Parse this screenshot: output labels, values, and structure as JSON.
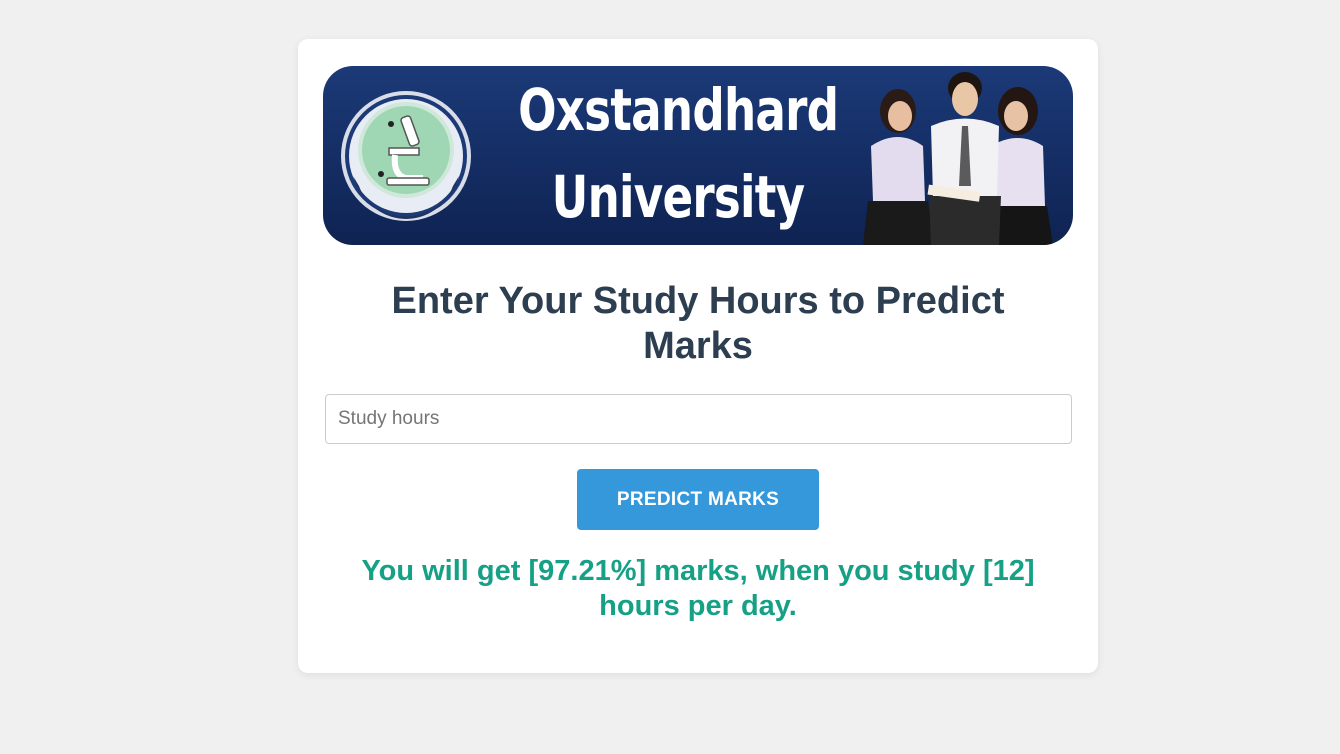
{
  "banner": {
    "line1": "Oxstandhard",
    "line2": "University",
    "logo_icon": "microscope-emblem-icon",
    "photo": "students-photo"
  },
  "form": {
    "heading": "Enter Your Study Hours to Predict Marks",
    "input_placeholder": "Study hours",
    "input_value": "",
    "button_label": "PREDICT MARKS"
  },
  "result": {
    "message": "You will get [97.21%] marks, when you study [12] hours per day."
  },
  "colors": {
    "page_background": "#f0f0f0",
    "card_background": "#ffffff",
    "banner_background": "#142d63",
    "heading": "#2c3e50",
    "button": "#3498db",
    "result_text": "#16a085"
  }
}
